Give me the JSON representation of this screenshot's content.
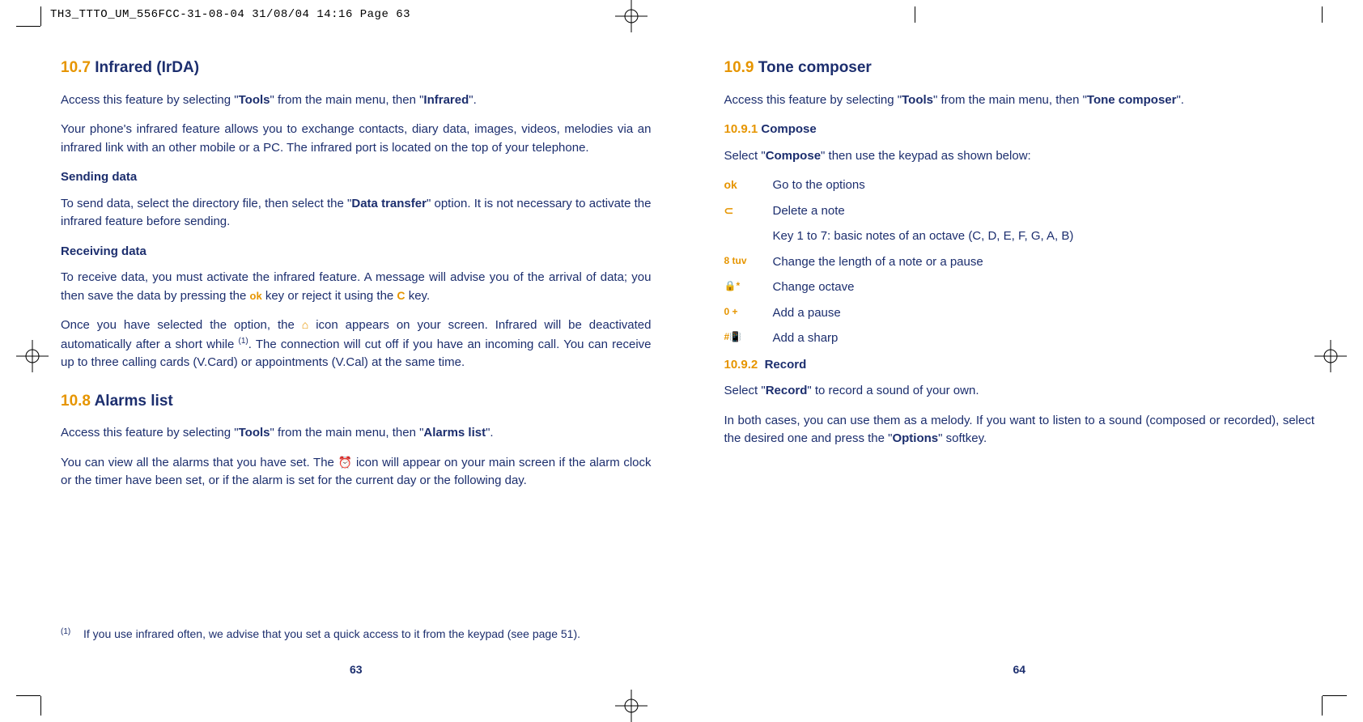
{
  "header_line": "TH3_TTTO_UM_556FCC-31-08-04  31/08/04  14:16  Page 63",
  "left_page": {
    "sec107_number": "10.7",
    "sec107_title": "Infrared (IrDA)",
    "p107_access_pre": "Access this feature by selecting \"",
    "p107_access_tools": "Tools",
    "p107_access_mid": "\" from the main menu, then \"",
    "p107_access_infrared": "Infrared",
    "p107_access_post": "\".",
    "p107_desc": "Your phone's infrared feature allows you to exchange contacts, diary data, images, videos, melodies via an infrared link with an other mobile or a PC. The infrared port is located on the top of your telephone.",
    "sending_heading": "Sending data",
    "sending_pre": "To send data, select the directory file, then select the \"",
    "sending_bold": "Data transfer",
    "sending_post": "\" option. It is not necessary to activate the infrared feature before sending.",
    "receiving_heading": "Receiving data",
    "receiving_p1_a": "To receive data, you must activate the infrared feature. A message will advise you of the arrival of data; you then save the data by pressing the ",
    "ok_icon": "ok",
    "receiving_p1_b": " key or reject it using the ",
    "c_icon": "C",
    "receiving_p1_c": " key.",
    "receiving_p2_a": "Once you have selected the option, the ",
    "ir_icon": "⌂",
    "receiving_p2_b": " icon appears on your screen. Infrared will be deactivated automatically after a short while ",
    "receiving_p2_sup": "(1)",
    "receiving_p2_c": ". The connection will cut off if you have an incoming call. You can receive up to three calling cards (V.Card) or appointments (V.Cal) at the same time.",
    "sec108_number": "10.8",
    "sec108_title": "Alarms list",
    "p108_access_pre": "Access this feature by selecting \"",
    "p108_access_tools": "Tools",
    "p108_access_mid": "\" from the main menu, then \"",
    "p108_access_alarms": "Alarms list",
    "p108_access_post": "\".",
    "p108_body_a": "You can view all the alarms that you have set. The ",
    "alarm_icon": "⏰",
    "p108_body_b": " icon will appear on your main screen if the alarm clock or the timer have been set, or if the alarm is set for the current day or the following day.",
    "footnote_sup": "(1)",
    "footnote_text": "If you use infrared often, we advise that you set a quick access to it from the keypad (see page 51).",
    "page_number": "63"
  },
  "right_page": {
    "sec109_number": "10.9",
    "sec109_title": "Tone composer",
    "p109_access_pre": "Access this feature by selecting \"",
    "p109_access_tools": "Tools",
    "p109_access_mid": "\" from the main menu, then \"",
    "p109_access_tone": "Tone composer",
    "p109_access_post": "\".",
    "sub1091_number": "10.9.1",
    "sub1091_title": "Compose",
    "compose_intro_pre": "Select \"",
    "compose_intro_bold": "Compose",
    "compose_intro_post": "\" then use the keypad as shown below:",
    "keys": [
      {
        "icon": "ok",
        "text": "Go to the options"
      },
      {
        "icon": "⊂",
        "text": "Delete a note"
      },
      {
        "icon": "",
        "text": "Key 1 to 7: basic notes of an octave (C, D, E, F, G, A, B)"
      },
      {
        "icon": "8 tuv",
        "text": "Change the length of a note or a pause"
      },
      {
        "icon": "🔒*",
        "text": "Change octave"
      },
      {
        "icon": "0 +",
        "text": "Add a pause"
      },
      {
        "icon": "#📳",
        "text": "Add a sharp"
      }
    ],
    "sub1092_number": "10.9.2",
    "sub1092_title": "Record",
    "record_intro_pre": "Select \"",
    "record_intro_bold": "Record",
    "record_intro_post": "\" to record a sound of your own.",
    "record_body_a": "In both cases, you can use them as a melody. If you want to listen to a sound (composed or recorded), select the desired one and press the \"",
    "record_body_bold": "Options",
    "record_body_b": "\" softkey.",
    "page_number": "64"
  }
}
